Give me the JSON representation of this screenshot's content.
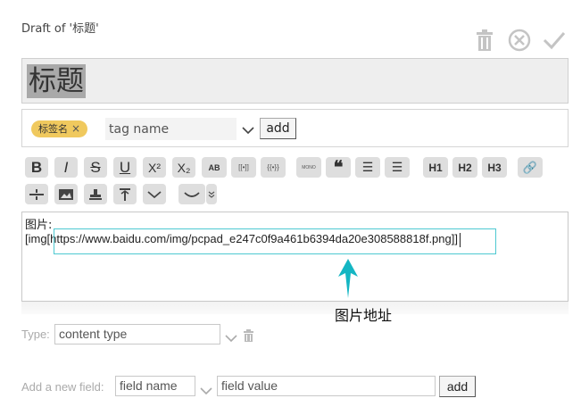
{
  "header": {
    "draft_title": "Draft of '标题'"
  },
  "title_field": {
    "value": "标题"
  },
  "tags": {
    "items": [
      {
        "label": "标签名"
      }
    ],
    "input_placeholder": "tag name",
    "add_label": "add"
  },
  "toolbar": {
    "buttons": [
      {
        "name": "bold",
        "label": "B"
      },
      {
        "name": "italic",
        "label": "I"
      },
      {
        "name": "strikethrough",
        "label": "S"
      },
      {
        "name": "underline",
        "label": "U"
      },
      {
        "name": "superscript",
        "label": "X²"
      },
      {
        "name": "subscript",
        "label": "X₂"
      },
      {
        "name": "small-caps",
        "label": "AB"
      },
      {
        "name": "wikilink",
        "label": "[[•]]"
      },
      {
        "name": "transclusion",
        "label": "{{•}}"
      },
      {
        "name": "monospace",
        "label": "MONO"
      },
      {
        "name": "quote",
        "label": "❝"
      },
      {
        "name": "bullet-list",
        "label": "☰"
      },
      {
        "name": "numbered-list",
        "label": "☰"
      },
      {
        "name": "heading-1",
        "label": "H1"
      },
      {
        "name": "heading-2",
        "label": "H2"
      },
      {
        "name": "heading-3",
        "label": "H3"
      },
      {
        "name": "link",
        "label": "🔗"
      }
    ]
  },
  "editor": {
    "line1": "图片:",
    "line2": "[img[https://www.baidu.com/img/pcpad_e247c0f9a461b6394da20e308588818f.png]]"
  },
  "annotation": {
    "label": "图片地址"
  },
  "type_field": {
    "label": "Type:",
    "value": "content type"
  },
  "new_field": {
    "label": "Add a new field:",
    "name_placeholder": "field name",
    "value_placeholder": "field value",
    "add_label": "add"
  }
}
